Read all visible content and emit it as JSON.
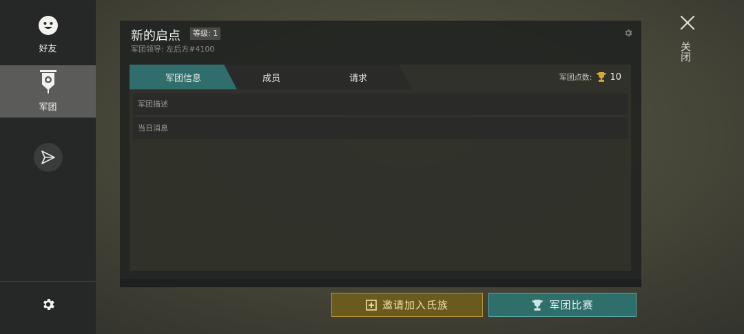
{
  "sidebar": {
    "friends_label": "好友",
    "legion_label": "军团",
    "icons": [
      "smiley-icon",
      "legion-banner-icon",
      "send-icon",
      "gear-icon"
    ]
  },
  "panel": {
    "title": "新的启点",
    "level_badge": "等级: 1",
    "subtitle": "军团领导: 左后方#4100",
    "tabs": [
      "军团信息",
      "成员",
      "请求"
    ],
    "points_label": "军团点数:",
    "points_value": "10",
    "rows": [
      "军团描述",
      "当日消息"
    ]
  },
  "buttons": {
    "invite": "邀请加入氏族",
    "contest": "军团比赛"
  },
  "close_label": "关闭",
  "colors": {
    "accent_teal": "#2f6e6c",
    "gold": "#b99631",
    "sidebar_bg": "#262727",
    "selected_bg": "#5b5c5a"
  }
}
